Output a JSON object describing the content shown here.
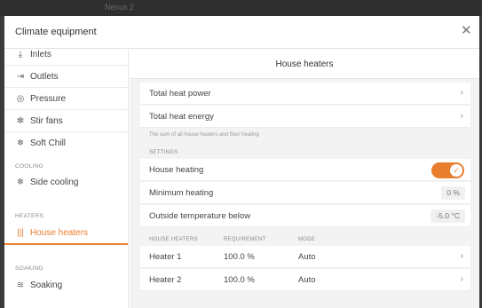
{
  "background_window": {
    "ghost_text": "Nexus 2"
  },
  "dialog": {
    "title": "Climate equipment"
  },
  "sidebar": {
    "items": [
      {
        "label": "Inlets",
        "icon": "inlet-icon"
      },
      {
        "label": "Outlets",
        "icon": "outlet-icon"
      },
      {
        "label": "Pressure",
        "icon": "pressure-icon"
      },
      {
        "label": "Stir fans",
        "icon": "stir-fan-icon"
      },
      {
        "label": "Soft Chill",
        "icon": "soft-chill-icon"
      }
    ],
    "cooling_section": "COOLING",
    "cooling_items": [
      {
        "label": "Side cooling",
        "icon": "side-cooling-icon"
      }
    ],
    "heaters_section": "HEATERS",
    "heaters_items": [
      {
        "label": "House heaters",
        "icon": "house-heaters-icon",
        "active": true
      }
    ],
    "soaking_section": "SOAKING",
    "soaking_items": [
      {
        "label": "Soaking",
        "icon": "soaking-icon"
      }
    ]
  },
  "main": {
    "title": "House heaters",
    "total_heat_power": "Total heat power",
    "total_heat_energy": "Total heat energy",
    "note": "The sum of all house heaters and floor heating",
    "settings_section": "SETTINGS",
    "house_heating_label": "House heating",
    "house_heating_on": true,
    "minimum_heating_label": "Minimum heating",
    "minimum_heating_value": "0 %",
    "outside_temp_label": "Outside temperature below",
    "outside_temp_value": "-5.0 °C",
    "table": {
      "headers": [
        "HOUSE HEATERS",
        "REQUIREMENT",
        "MODE"
      ],
      "rows": [
        {
          "name": "Heater 1",
          "requirement": "100.0 %",
          "mode": "Auto"
        },
        {
          "name": "Heater 2",
          "requirement": "100.0 %",
          "mode": "Auto"
        }
      ]
    }
  },
  "colors": {
    "accent": "#e87e2f",
    "panel_bg": "#f3f3f3"
  }
}
